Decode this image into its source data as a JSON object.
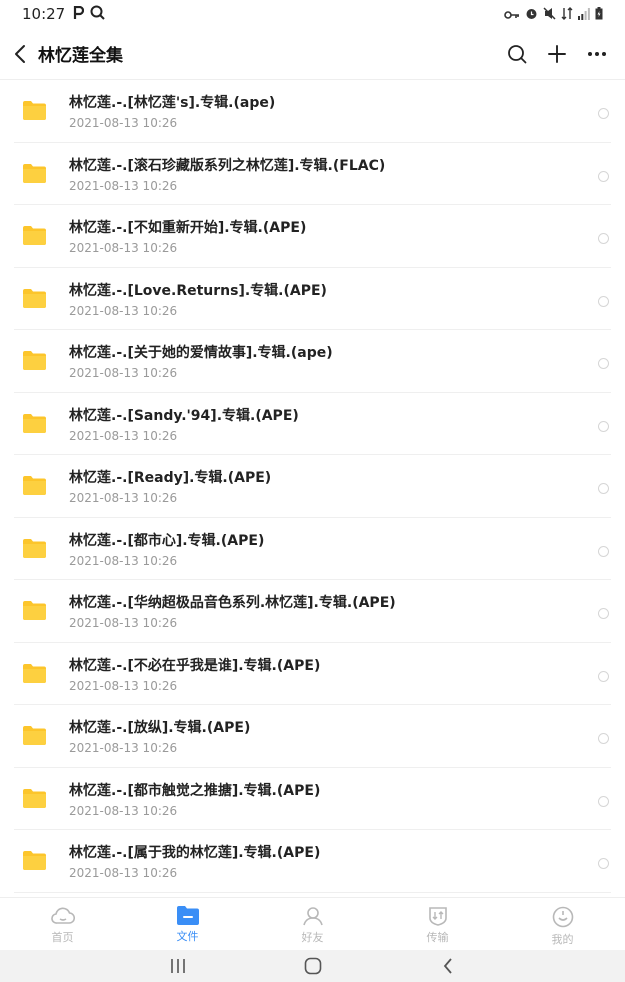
{
  "status_bar": {
    "time": "10:27",
    "left_icons": [
      "p-icon",
      "search-icon"
    ],
    "right_icons": [
      "key-icon",
      "alarm-icon",
      "mute-icon",
      "wifi-icon",
      "signal-icon",
      "battery-icon"
    ]
  },
  "header": {
    "title": "林忆莲全集"
  },
  "files": [
    {
      "name": "林忆莲.-.[林忆莲's].专辑.(ape)",
      "date": "2021-08-13  10:26"
    },
    {
      "name": "林忆莲.-.[滚石珍藏版系列之林忆莲].专辑.(FLAC)",
      "date": "2021-08-13  10:26"
    },
    {
      "name": "林忆莲.-.[不如重新开始].专辑.(APE)",
      "date": "2021-08-13  10:26"
    },
    {
      "name": "林忆莲.-.[Love.Returns].专辑.(APE)",
      "date": "2021-08-13  10:26"
    },
    {
      "name": "林忆莲.-.[关于她的爱情故事].专辑.(ape)",
      "date": "2021-08-13  10:26"
    },
    {
      "name": "林忆莲.-.[Sandy.'94].专辑.(APE)",
      "date": "2021-08-13  10:26"
    },
    {
      "name": "林忆莲.-.[Ready].专辑.(APE)",
      "date": "2021-08-13  10:26"
    },
    {
      "name": "林忆莲.-.[都市心].专辑.(APE)",
      "date": "2021-08-13  10:26"
    },
    {
      "name": "林忆莲.-.[华纳超极品音色系列.林忆莲].专辑.(APE)",
      "date": "2021-08-13  10:26"
    },
    {
      "name": "林忆莲.-.[不必在乎我是谁].专辑.(APE)",
      "date": "2021-08-13  10:26"
    },
    {
      "name": "林忆莲.-.[放纵].专辑.(APE)",
      "date": "2021-08-13  10:26"
    },
    {
      "name": "林忆莲.-.[都市触觉之推搪].专辑.(APE)",
      "date": "2021-08-13  10:26"
    },
    {
      "name": "林忆莲.-.[属于我的林忆莲].专辑.(APE)",
      "date": "2021-08-13  10:26"
    }
  ],
  "tabs": [
    {
      "label": "首页",
      "icon": "cloud-home-icon",
      "active": false
    },
    {
      "label": "文件",
      "icon": "folder-icon",
      "active": true
    },
    {
      "label": "好友",
      "icon": "friends-icon",
      "active": false
    },
    {
      "label": "传输",
      "icon": "transfer-icon",
      "active": false
    },
    {
      "label": "我的",
      "icon": "profile-icon",
      "active": false
    }
  ],
  "colors": {
    "accent": "#3a8ef6",
    "folder": "#fcc52b",
    "inactive_tab": "#b8b8b8"
  }
}
